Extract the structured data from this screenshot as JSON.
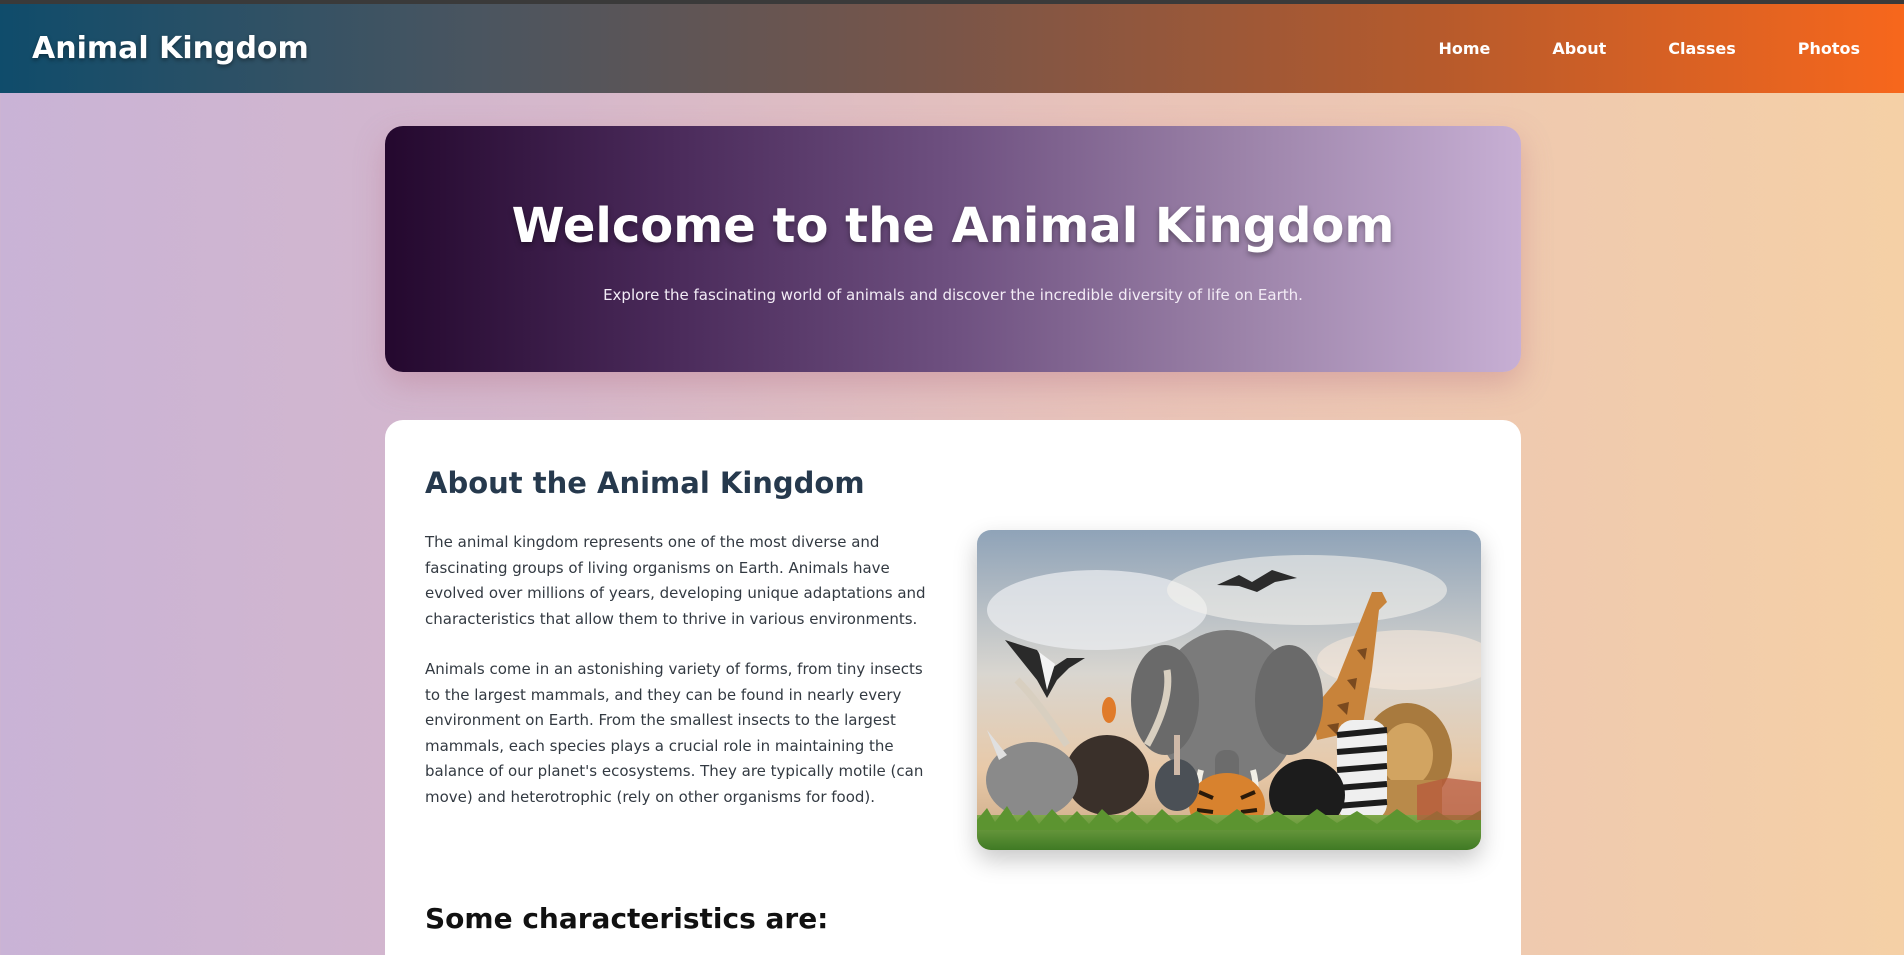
{
  "header": {
    "brand": "Animal Kingdom",
    "nav": [
      "Home",
      "About",
      "Classes",
      "Photos"
    ]
  },
  "hero": {
    "title": "Welcome to the Animal Kingdom",
    "subtitle": "Explore the fascinating world of animals and discover the incredible diversity of life on Earth."
  },
  "about": {
    "title": "About the Animal Kingdom",
    "paragraphs": [
      "The animal kingdom represents one of the most diverse and fascinating groups of living organisms on Earth. Animals have evolved over millions of years, developing unique adaptations and characteristics that allow them to thrive in various environments.",
      "Animals come in an astonishing variety of forms, from tiny insects to the largest mammals, and they can be found in nearly every environment on Earth. From the smallest insects to the largest mammals, each species plays a crucial role in maintaining the balance of our planet's ecosystems. They are typically motile (can move) and heterotrophic (rely on other organisms for food)."
    ],
    "image_icon": "animals-group-photo",
    "characteristics_title": "Some characteristics are:"
  },
  "colors": {
    "nav_start": "#0f4c6b",
    "nav_end": "#f7671c",
    "hero_start": "#24082e",
    "hero_end": "#c7afd4",
    "heading": "#26394d"
  }
}
